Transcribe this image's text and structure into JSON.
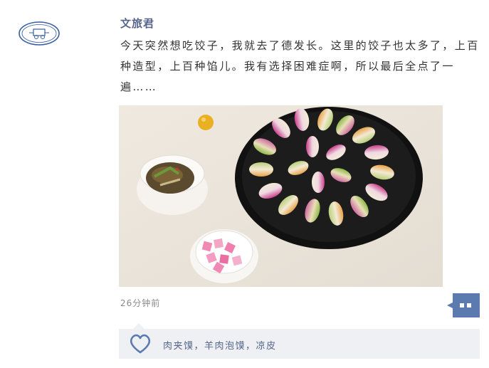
{
  "post": {
    "author": "文旅君",
    "text": "今天突然想吃饺子，我就去了德发长。这里的饺子也太多了，上百种造型，上百种馅儿。我有选择困难症啊，所以最后全点了一遍……",
    "timestamp": "26分钟前"
  },
  "avatar": {
    "icon": "carriage-logo-icon"
  },
  "actions": {
    "comment_icon": "comment-bubble-icon"
  },
  "likes": {
    "icon": "heart-icon",
    "names": "肉夹馍，羊肉泡馍，凉皮"
  },
  "colors": {
    "author_name": "#55668a",
    "body_text": "#333333",
    "timestamp": "#8a8a8a",
    "likes_bg": "#eef0f4",
    "accent_blue": "#5b7bb0"
  }
}
